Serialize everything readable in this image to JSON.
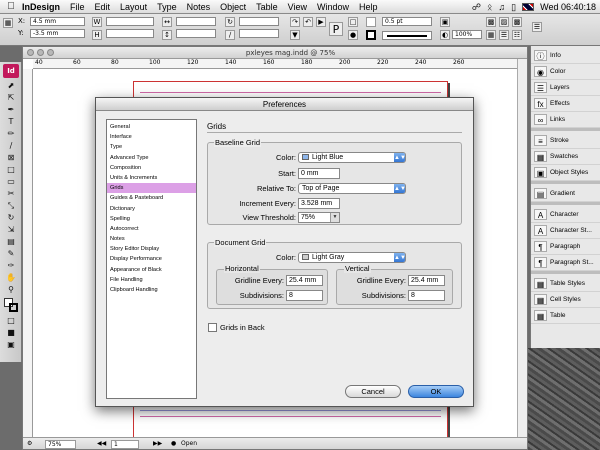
{
  "menubar": {
    "app": "InDesign",
    "items": [
      "File",
      "Edit",
      "Layout",
      "Type",
      "Notes",
      "Object",
      "Table",
      "View",
      "Window",
      "Help"
    ],
    "clock": "Wed 06:40:18"
  },
  "control": {
    "x_label": "X:",
    "x_value": "4.5 mm",
    "y_label": "Y:",
    "y_value": "-3.5 mm",
    "stroke_weight": "0.5 pt",
    "opacity": "100%"
  },
  "document": {
    "title": "pxleyes mag.indd @ 75%",
    "ruler_ticks": [
      "40",
      "60",
      "80",
      "100",
      "120",
      "140",
      "160",
      "180",
      "200",
      "220",
      "240",
      "260"
    ],
    "zoom": "75%",
    "page": "1",
    "status": "Open"
  },
  "panels": {
    "group1": [
      "Info",
      "Color",
      "Layers",
      "Effects",
      "Links"
    ],
    "group2": [
      "Stroke",
      "Swatches",
      "Object Styles"
    ],
    "group3": [
      "Gradient"
    ],
    "group4": [
      "Character",
      "Character St...",
      "Paragraph",
      "Paragraph St..."
    ],
    "group5": [
      "Table Styles",
      "Cell Styles",
      "Table"
    ]
  },
  "preferences": {
    "title": "Preferences",
    "categories": [
      "General",
      "Interface",
      "Type",
      "Advanced Type",
      "Composition",
      "Units & Increments",
      "Grids",
      "Guides & Pasteboard",
      "Dictionary",
      "Spelling",
      "Autocorrect",
      "Notes",
      "Story Editor Display",
      "Display Performance",
      "Appearance of Black",
      "File Handling",
      "Clipboard Handling"
    ],
    "selected_category": "Grids",
    "section_title": "Grids",
    "baseline": {
      "label": "Baseline Grid",
      "color_label": "Color:",
      "color_value": "Light Blue",
      "color_hex": "#8fb7ec",
      "start_label": "Start:",
      "start_value": "0 mm",
      "relative_label": "Relative To:",
      "relative_value": "Top of Page",
      "increment_label": "Increment Every:",
      "increment_value": "3.528 mm",
      "threshold_label": "View Threshold:",
      "threshold_value": "75%"
    },
    "document_grid": {
      "label": "Document Grid",
      "color_label": "Color:",
      "color_value": "Light Gray",
      "color_hex": "#cfcfcf",
      "horizontal": {
        "label": "Horizontal",
        "gridline_label": "Gridline Every:",
        "gridline_value": "25.4 mm",
        "subdiv_label": "Subdivisions:",
        "subdiv_value": "8"
      },
      "vertical": {
        "label": "Vertical",
        "gridline_label": "Gridline Every:",
        "gridline_value": "25.4 mm",
        "subdiv_label": "Subdivisions:",
        "subdiv_value": "8"
      }
    },
    "grids_in_back": "Grids in Back",
    "cancel": "Cancel",
    "ok": "OK"
  }
}
